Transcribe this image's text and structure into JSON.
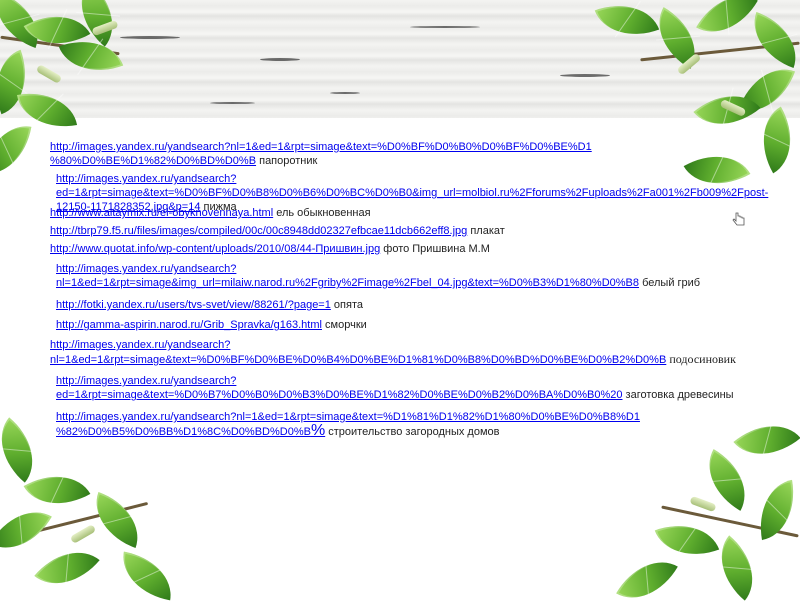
{
  "links": [
    {
      "url": "http://images.yandex.ru/yandsearch?nl=1&ed=1&rpt=simage&text=%D0%BF%D0%B0%D0%BF%D0%BE%D1 %80%D0%BE%D1%82%D0%BD%D0%B",
      "label": "папоротник"
    },
    {
      "url": "http://images.yandex.ru/yandsearch?ed=1&rpt=simage&text=%D0%BF%D0%B8%D0%B6%D0%BC%D0%B0&img_url=molbiol.ru%2Fforums%2Fuploads%2Fa001%2Fb009%2Fpost-12150-1171828352.jpg&p=14",
      "label": "пижма"
    },
    {
      "url": "http://www.altaymix.ru/el-obyknovennaya.html",
      "label": "ель обыкновенная"
    },
    {
      "url": "http://tbrp79.f5.ru/files/images/compiled/00c/00c8948dd02327efbcae11dcb662eff8.jpg",
      "label": "плакат"
    },
    {
      "url": "http://www.quotat.info/wp-content/uploads/2010/08/44-Пришвин.jpg",
      "label": "фото Пришвина М.М"
    },
    {
      "url": "http://images.yandex.ru/yandsearch?nl=1&ed=1&rpt=simage&img_url=milaiw.narod.ru%2Fgriby%2Fimage%2Fbel_04.jpg&text=%D0%B3%D1%80%D0%B8",
      "label": "белый гриб"
    },
    {
      "url": "http://fotki.yandex.ru/users/tvs-svet/view/88261/?page=1",
      "label": "опята"
    },
    {
      "url": "http://gamma-aspirin.narod.ru/Grib_Spravka/g163.html",
      "label": "сморчки"
    },
    {
      "url": "http://images.yandex.ru/yandsearch?nl=1&ed=1&rpt=simage&text=%D0%BF%D0%BE%D0%B4%D0%BE%D1%81%D0%B8%D0%BD%D0%BE%D0%B2%D0%B",
      "label": "подосиновик"
    },
    {
      "url": "http://images.yandex.ru/yandsearch?ed=1&rpt=simage&text=%D0%B7%D0%B0%D0%B3%D0%BE%D1%82%D0%BE%D0%B2%D0%BA%D0%B0%20",
      "label": "заготовка древесины"
    },
    {
      "url": "http://images.yandex.ru/yandsearch?nl=1&ed=1&rpt=simage&text=%D1%81%D1%82%D1%80%D0%BE%D0%B8%D1 %82%D0%B5%D0%BB%D1%8C%D0%BD%D0%B",
      "suffix": "%",
      "label": "строительство загородных домов"
    }
  ]
}
